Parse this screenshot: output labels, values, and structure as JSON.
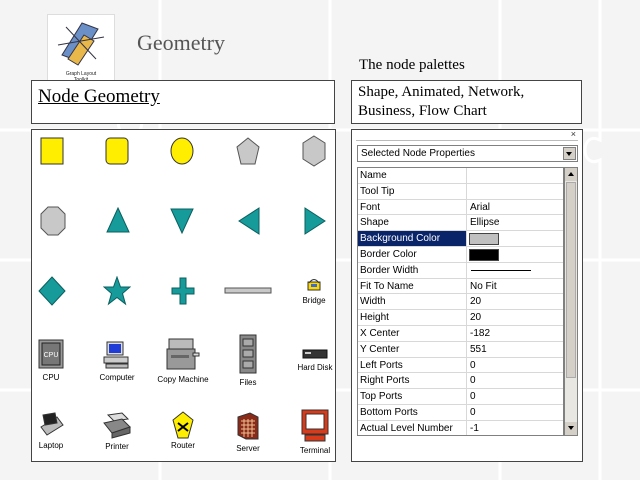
{
  "slide": {
    "title": "Geometry",
    "subtitle": "The node palettes",
    "node_geometry_label": "Node Geometry",
    "palettes_text": "Shape, Animated, Network, Business, Flow Chart"
  },
  "shapes": [
    {
      "name": "square",
      "color": "#ffee00"
    },
    {
      "name": "rounded-square",
      "color": "#ffee00"
    },
    {
      "name": "circle",
      "color": "#ffee00"
    },
    {
      "name": "pentagon",
      "color": "#c8c8c8"
    },
    {
      "name": "hexagon",
      "color": "#c8c8c8"
    },
    {
      "name": "octagon",
      "color": "#c8c8c8"
    },
    {
      "name": "triangle-up",
      "color": "#169a9a"
    },
    {
      "name": "triangle-down",
      "color": "#169a9a"
    },
    {
      "name": "triangle-left",
      "color": "#169a9a"
    },
    {
      "name": "triangle-right",
      "color": "#169a9a"
    },
    {
      "name": "diamond",
      "color": "#169a9a"
    },
    {
      "name": "star",
      "color": "#169a9a"
    },
    {
      "name": "cross",
      "color": "#169a9a"
    },
    {
      "name": "bar",
      "color": "#c8c8c8"
    }
  ],
  "network_icons": [
    {
      "name": "bridge",
      "caption": "Bridge"
    },
    {
      "name": "cpu",
      "caption": "CPU"
    },
    {
      "name": "computer",
      "caption": "Computer"
    },
    {
      "name": "copy-machine",
      "caption": "Copy Machine"
    },
    {
      "name": "files",
      "caption": "Files"
    },
    {
      "name": "hard-disk",
      "caption": "Hard Disk"
    },
    {
      "name": "laptop",
      "caption": "Laptop"
    },
    {
      "name": "printer",
      "caption": "Printer"
    },
    {
      "name": "router",
      "caption": "Router"
    },
    {
      "name": "server",
      "caption": "Server"
    },
    {
      "name": "terminal",
      "caption": "Terminal"
    }
  ],
  "properties": {
    "dropdown_value": "Selected Node Properties",
    "close_glyph": "×",
    "rows": [
      {
        "key": "Name",
        "value": ""
      },
      {
        "key": "Tool Tip",
        "value": ""
      },
      {
        "key": "Font",
        "value": "Arial"
      },
      {
        "key": "Shape",
        "value": "Ellipse"
      },
      {
        "key": "Background Color",
        "value": "",
        "swatch": "#c0c0c0",
        "selected": true
      },
      {
        "key": "Border Color",
        "value": "",
        "swatch": "#000000"
      },
      {
        "key": "Border Width",
        "value": "",
        "line": true
      },
      {
        "key": "Fit To Name",
        "value": "No Fit"
      },
      {
        "key": "Width",
        "value": "20"
      },
      {
        "key": "Height",
        "value": "20"
      },
      {
        "key": "X Center",
        "value": "-182"
      },
      {
        "key": "Y Center",
        "value": "551"
      },
      {
        "key": "Left Ports",
        "value": "0"
      },
      {
        "key": "Right Ports",
        "value": "0"
      },
      {
        "key": "Top Ports",
        "value": "0"
      },
      {
        "key": "Bottom Ports",
        "value": "0"
      },
      {
        "key": "Actual Level Number",
        "value": "-1"
      }
    ]
  }
}
